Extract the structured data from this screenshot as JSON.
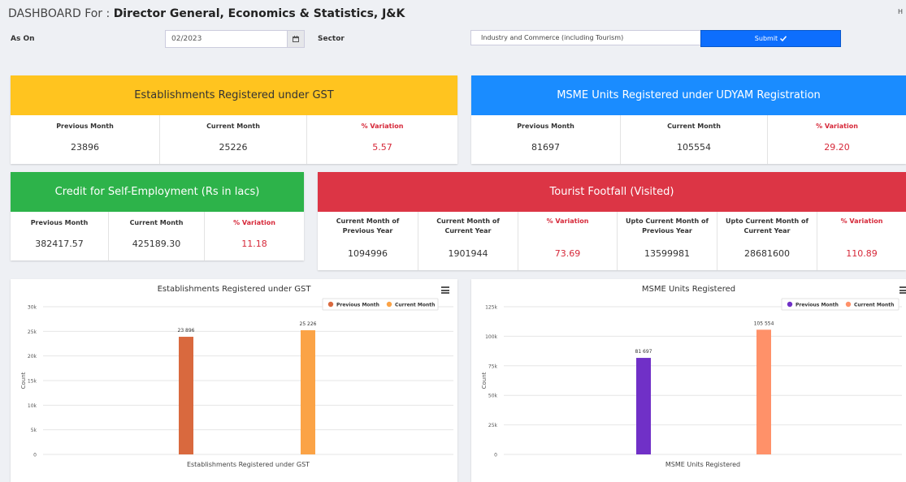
{
  "header": {
    "title_prefix": "DASHBOARD For :",
    "title_org": "Director General, Economics & Statistics, J&K",
    "corner_text": "H"
  },
  "filters": {
    "as_on_label": "As On",
    "date_value": "02/2023",
    "sector_label": "Sector",
    "sector_value": "Industry and Commerce (including Tourism)",
    "submit_label": "Submit"
  },
  "cards": {
    "gst": {
      "title": "Establishments Registered under GST",
      "color": "#ffc41f",
      "prev_label": "Previous Month",
      "prev_value": "23896",
      "curr_label": "Current Month",
      "curr_value": "25226",
      "var_label": "% Variation",
      "var_value": "5.57"
    },
    "msme": {
      "title": "MSME Units Registered under UDYAM Registration",
      "color": "#1a8cff",
      "prev_label": "Previous Month",
      "prev_value": "81697",
      "curr_label": "Current Month",
      "curr_value": "105554",
      "var_label": "% Variation",
      "var_value": "29.20"
    },
    "credit": {
      "title": "Credit for Self-Employment (Rs in lacs)",
      "color": "#2db34a",
      "prev_label": "Previous Month",
      "prev_value": "382417.57",
      "curr_label": "Current Month",
      "curr_value": "425189.30",
      "var_label": "% Variation",
      "var_value": "11.18"
    },
    "tourist": {
      "title": "Tourist Footfall (Visited)",
      "color": "#dc3545",
      "c1_label": "Current Month of Previous Year",
      "c1_value": "1094996",
      "c2_label": "Current Month of Current Year",
      "c2_value": "1901944",
      "c3_label": "% Variation",
      "c3_value": "73.69",
      "c4_label": "Upto Current Month of Previous Year",
      "c4_value": "13599981",
      "c5_label": "Upto Current Month of Current Year",
      "c5_value": "28681600",
      "c6_label": "% Variation",
      "c6_value": "110.89"
    }
  },
  "chart_data": [
    {
      "type": "bar",
      "title": "Establishments Registered under GST",
      "xlabel": "Establishments Registered under GST",
      "ylabel": "Count",
      "ylim": [
        0,
        30000
      ],
      "yticks": [
        0,
        5000,
        10000,
        15000,
        20000,
        25000,
        30000
      ],
      "ytick_labels": [
        "0",
        "5k",
        "10k",
        "15k",
        "20k",
        "25k",
        "30k"
      ],
      "grid": true,
      "legend_position": "top-right",
      "series": [
        {
          "name": "Previous Month",
          "values": [
            23896
          ],
          "label": "23 896",
          "color": "#d9693e"
        },
        {
          "name": "Current Month",
          "values": [
            25226
          ],
          "label": "25 226",
          "color": "#fba346"
        }
      ]
    },
    {
      "type": "bar",
      "title": "MSME Units Registered",
      "xlabel": "MSME Units Registered",
      "ylabel": "Count",
      "ylim": [
        0,
        125000
      ],
      "yticks": [
        0,
        25000,
        50000,
        75000,
        100000,
        125000
      ],
      "ytick_labels": [
        "0",
        "25k",
        "50k",
        "75k",
        "100k",
        "125k"
      ],
      "grid": true,
      "legend_position": "top-right",
      "series": [
        {
          "name": "Previous Month",
          "values": [
            81697
          ],
          "label": "81 697",
          "color": "#7030c7"
        },
        {
          "name": "Current Month",
          "values": [
            105554
          ],
          "label": "105 554",
          "color": "#ff9169"
        }
      ]
    }
  ]
}
